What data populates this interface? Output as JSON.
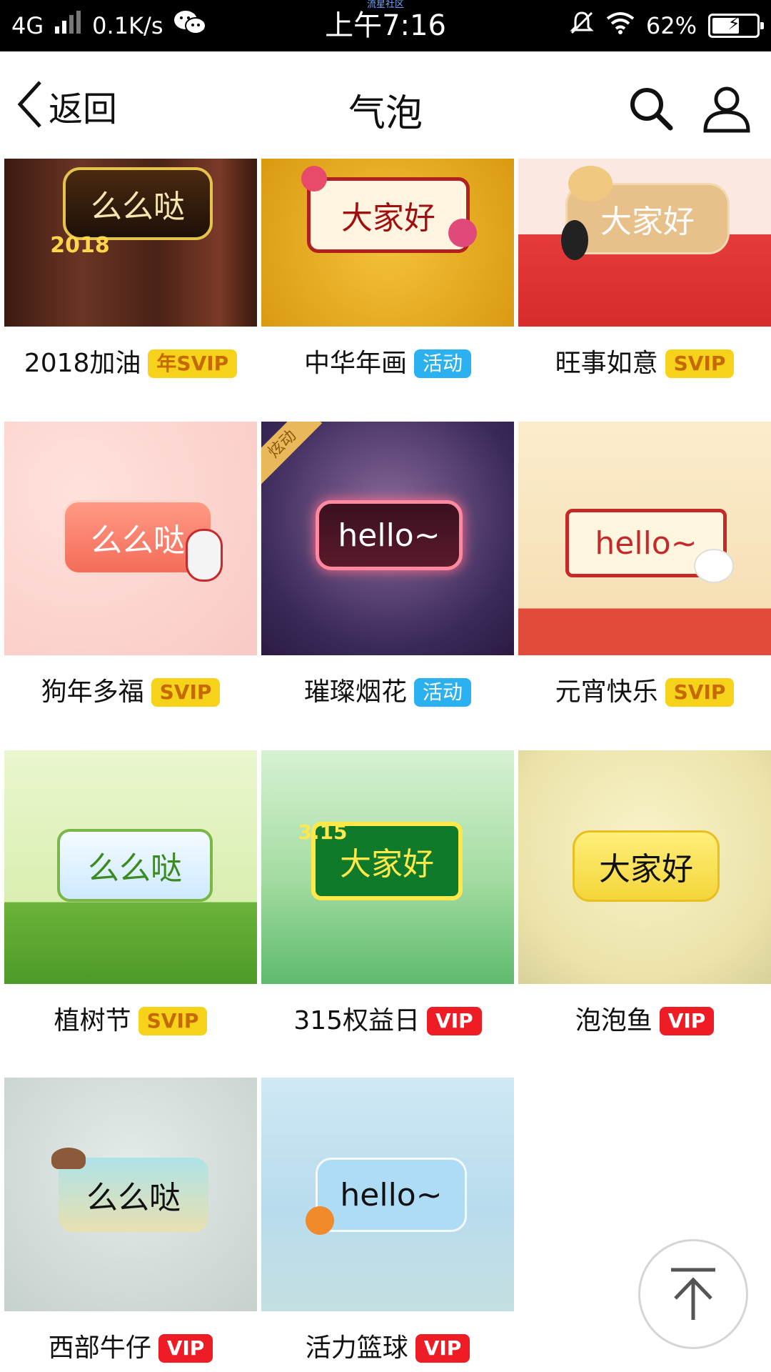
{
  "status_bar": {
    "network": "4G",
    "speed": "0.1K/s",
    "time": "上午7:16",
    "community_label": "流星社区",
    "battery_percent": "62%",
    "battery_level": 0.62
  },
  "header": {
    "back_label": "返回",
    "title": "气泡"
  },
  "items": [
    {
      "name": "2018加油",
      "badge": "年SVIP",
      "badge_type": "suip",
      "bubble_text": "么么哒",
      "extra_text": "2018"
    },
    {
      "name": "中华年画",
      "badge": "活动",
      "badge_type": "huodong",
      "bubble_text": "大家好"
    },
    {
      "name": "旺事如意",
      "badge": "SVIP",
      "badge_type": "suip",
      "bubble_text": "大家好"
    },
    {
      "name": "狗年多福",
      "badge": "SVIP",
      "badge_type": "suip",
      "bubble_text": "么么哒"
    },
    {
      "name": "璀璨烟花",
      "badge": "活动",
      "badge_type": "huodong",
      "bubble_text": "hello~",
      "corner_tag": "炫动"
    },
    {
      "name": "元宵快乐",
      "badge": "SVIP",
      "badge_type": "suip",
      "bubble_text": "hello~"
    },
    {
      "name": "植树节",
      "badge": "SVIP",
      "badge_type": "suip",
      "bubble_text": "么么哒"
    },
    {
      "name": "315权益日",
      "badge": "VIP",
      "badge_type": "vip",
      "bubble_text": "大家好",
      "extra_text": "3.15"
    },
    {
      "name": "泡泡鱼",
      "badge": "VIP",
      "badge_type": "vip",
      "bubble_text": "大家好"
    },
    {
      "name": "西部牛仔",
      "badge": "VIP",
      "badge_type": "vip",
      "bubble_text": "么么哒"
    },
    {
      "name": "活力篮球",
      "badge": "VIP",
      "badge_type": "vip",
      "bubble_text": "hello~"
    }
  ],
  "colors": {
    "suip_badge": "#f7d21b",
    "huodong_badge": "#2bb0f0",
    "vip_badge": "#ee1c25"
  }
}
